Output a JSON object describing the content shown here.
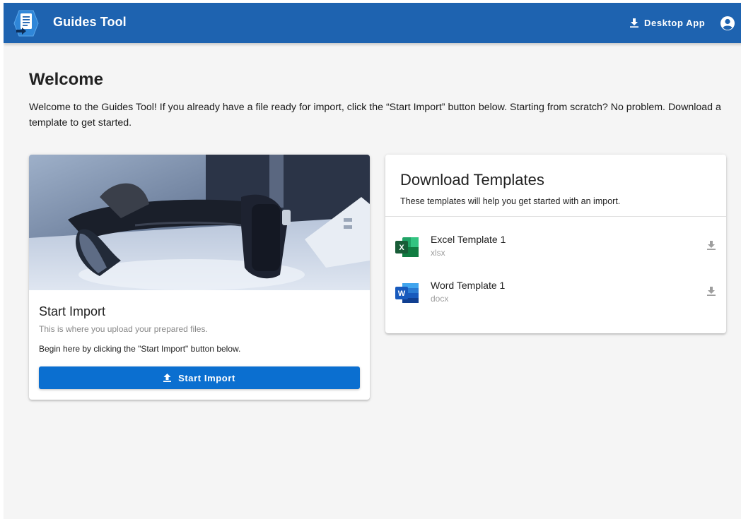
{
  "app": {
    "title": "Guides Tool",
    "desktop_app_label": "Desktop App",
    "colors": {
      "appbar": "#1e63b0",
      "primary_button": "#0b6fd0",
      "background": "#f5f5f5"
    }
  },
  "welcome": {
    "title": "Welcome",
    "text": "Welcome to the Guides Tool! If you already have a file ready for import, click the “Start Import” button below. Starting from scratch? No problem. Download a template to get started."
  },
  "import_card": {
    "title": "Start Import",
    "subtitle": "This is where you upload your prepared files.",
    "description": "Begin here by clicking the \"Start Import\" button below.",
    "button_label": "Start Import"
  },
  "templates_card": {
    "title": "Download Templates",
    "subtitle": "These templates will help you get started with an import.",
    "items": [
      {
        "name": "Excel Template 1",
        "ext": "xlsx",
        "icon": "excel-icon"
      },
      {
        "name": "Word Template 1",
        "ext": "docx",
        "icon": "word-icon"
      }
    ]
  }
}
